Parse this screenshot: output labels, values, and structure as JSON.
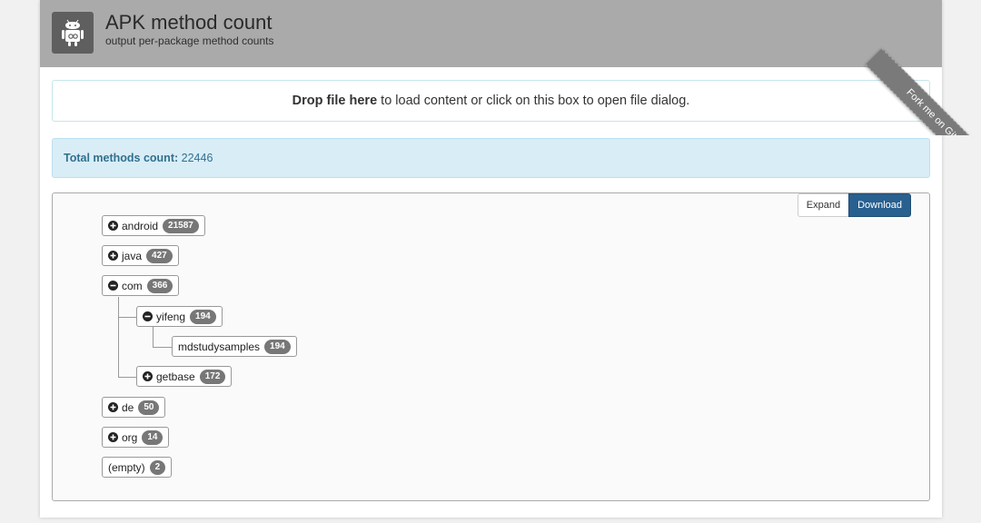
{
  "header": {
    "title": "APK method count",
    "subtitle": "output per-package method counts",
    "logo_icon": "android-robot-icon"
  },
  "dropzone": {
    "bold_text": "Drop file here",
    "rest_text": " to load content or click on this box to open file dialog."
  },
  "summary": {
    "label": "Total methods count:",
    "value": "22446"
  },
  "toolbar": {
    "expand_label": "Expand",
    "download_label": "Download"
  },
  "tree": {
    "nodes": [
      {
        "label": "android",
        "count": "21587",
        "state": "collapsed"
      },
      {
        "label": "java",
        "count": "427",
        "state": "collapsed"
      },
      {
        "label": "com",
        "count": "366",
        "state": "expanded"
      },
      {
        "label": "yifeng",
        "count": "194",
        "state": "expanded"
      },
      {
        "label": "mdstudysamples",
        "count": "194",
        "state": "leaf"
      },
      {
        "label": "getbase",
        "count": "172",
        "state": "collapsed"
      },
      {
        "label": "de",
        "count": "50",
        "state": "collapsed"
      },
      {
        "label": "org",
        "count": "14",
        "state": "collapsed"
      },
      {
        "label": "(empty)",
        "count": "2",
        "state": "leaf"
      }
    ]
  },
  "ribbon": {
    "text": "Fork me on GitHub"
  },
  "colors": {
    "header_bg": "#aaaaaa",
    "info_bg": "#d9edf7",
    "info_text": "#31708f",
    "primary_button": "#286090",
    "badge": "#777777"
  }
}
